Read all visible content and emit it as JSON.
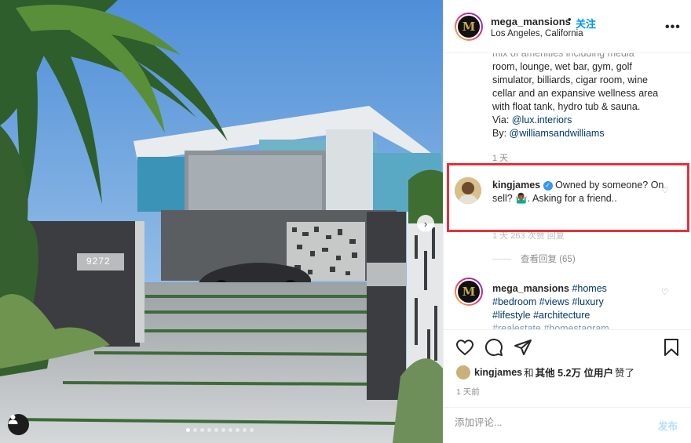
{
  "post": {
    "photo_alt": "Modern mansion entrance",
    "house_number": "9272",
    "carousel_total": 10,
    "carousel_active": 0
  },
  "header": {
    "username": "mega_mansions",
    "separator": "•",
    "follow_label": "关注",
    "location": "Los Angeles, California",
    "more_icon": "more-horizontal-icon"
  },
  "caption": {
    "clipped_line": "mix of amenities including media",
    "lines": [
      "room, lounge, wet bar, gym, golf",
      "simulator, billiards, cigar room, wine",
      "cellar and an expansive wellness area",
      "with float tank, hydro tub & sauna."
    ],
    "via_label": "Via: ",
    "via_link": "@lux.interiors",
    "by_label": "By: ",
    "by_link": "@williamsandwilliams",
    "time": "1 天"
  },
  "comment1": {
    "username": "kingjames",
    "verified": true,
    "text": "Owned by someone? On sell? 🤷🏾‍♂️. Asking for a friend..",
    "meta": "1 天   263 次赞   回复",
    "replies_label": "查看回复 (65)"
  },
  "comment2": {
    "username": "mega_mansions",
    "hashtags_line1": "#homes",
    "hashtags_line2": "#bedroom #views #luxury",
    "hashtags_line3": "#lifestyle #architecture",
    "hashtags_line4": "#realestate #homestagram"
  },
  "actions": {
    "like_icon": "heart-icon",
    "comment_icon": "comment-icon",
    "share_icon": "paper-plane-icon",
    "save_icon": "bookmark-icon"
  },
  "likes": {
    "user": "kingjames",
    "and": " 和 ",
    "others": "其他 5.2万 位用户",
    "suffix": " 赞了"
  },
  "post_time": "1 天前",
  "add_comment": {
    "placeholder": "添加评论...",
    "post_label": "发布"
  },
  "colors": {
    "accent": "#0095f6",
    "highlight_box": "#e8303a",
    "muted": "#8e8e8e"
  }
}
